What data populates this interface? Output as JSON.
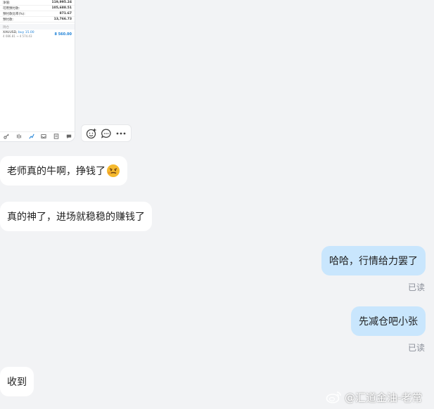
{
  "screenshot": {
    "rows": [
      {
        "label": "净值:",
        "value": "119,995.24"
      },
      {
        "label": "可用预付款:",
        "value": "105,688.51"
      },
      {
        "label": "预付款比率(%):",
        "value": "871.67"
      },
      {
        "label": "预付款:",
        "value": "13,766.73"
      }
    ],
    "section_label": "持仓",
    "position": {
      "symbol": "XAUUSD,",
      "side": "buy 15.00",
      "prices": "4 086.81 → 4 574.43",
      "profit": "8 560.00"
    },
    "tabs": [
      "key-icon",
      "chart-icon",
      "trade-icon",
      "inbox-icon",
      "journal-icon",
      "chat-icon"
    ]
  },
  "actions": {
    "icons": [
      "add-emoji-icon",
      "reply-icon",
      "more-icon"
    ]
  },
  "messages": [
    {
      "side": "in",
      "text": "老师真的牛啊，挣钱了"
    },
    {
      "side": "in",
      "text": "真的神了，进场就稳稳的赚钱了"
    },
    {
      "side": "out",
      "text": "哈哈，行情给力罢了",
      "status": "已读"
    },
    {
      "side": "out",
      "text": "先减仓吧小张",
      "status": "已读"
    },
    {
      "side": "in",
      "text": "收到"
    }
  ],
  "watermark": "@汇道金油-老常",
  "colors": {
    "page_bg": "#f2f3f5",
    "outgoing_bubble": "#c9e6fd",
    "incoming_bubble": "#ffffff",
    "accent": "#1a7fd6"
  }
}
